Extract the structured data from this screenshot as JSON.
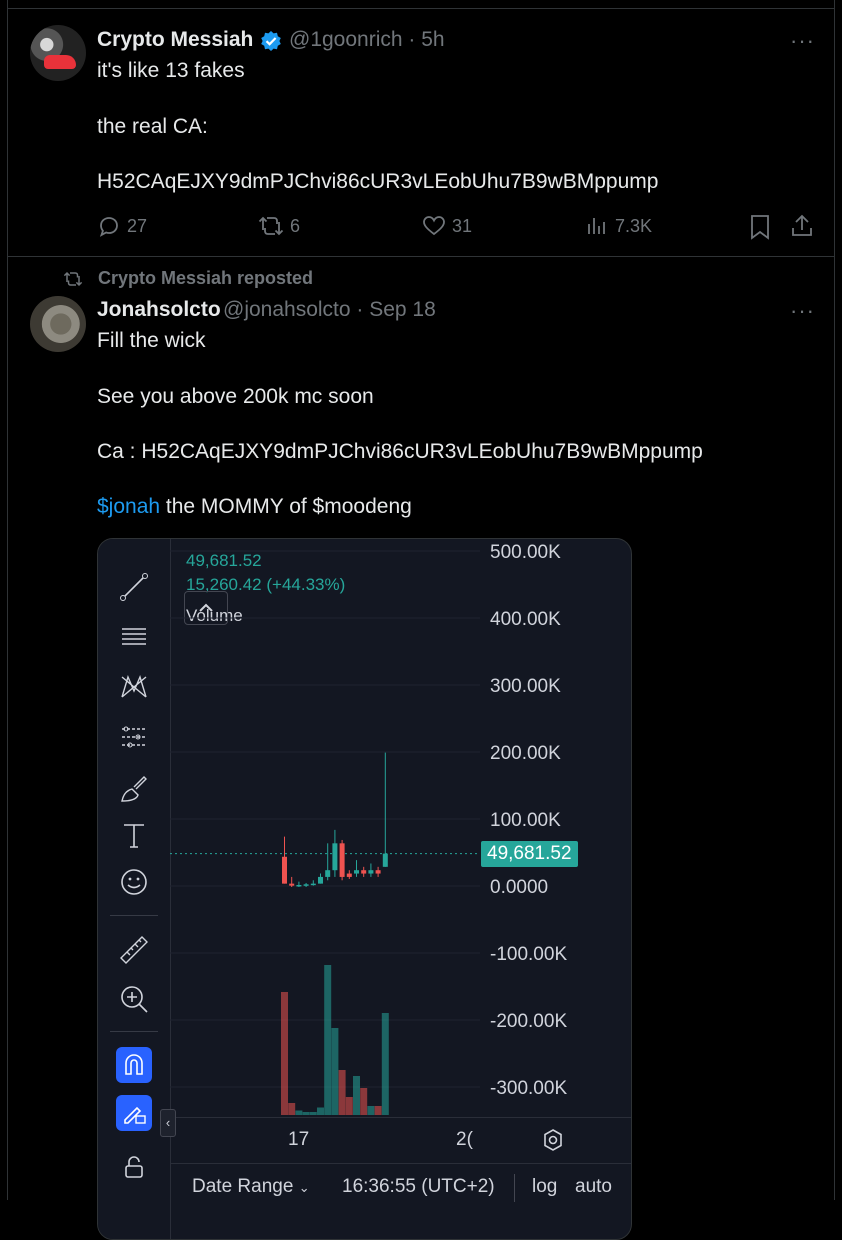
{
  "tweet1": {
    "name": "Crypto Messiah",
    "handle": "@1goonrich · 5h",
    "lines": [
      "it's like 13 fakes",
      "the real CA:",
      "H52CAqEJXY9dmPJChvi86cUR3vLEobUhu7B9wBMppump"
    ],
    "replies": "27",
    "reposts": "6",
    "likes": "31",
    "views": "7.3K",
    "more": "···"
  },
  "repost_label": "Crypto Messiah reposted",
  "tweet2": {
    "name": "Jonahsolcto",
    "handle": "@jonahsolcto · Sep 18",
    "lines": [
      "Fill the wick",
      "See you above 200k mc soon",
      "Ca : H52CAqEJXY9dmPJChvi86cUR3vLEobUhu7B9wBMppump"
    ],
    "cashtag": "$jonah",
    "last_line_rest": " the MOMMY of $moodeng",
    "more": "···"
  },
  "chart": {
    "price": "49,681.52",
    "change": "15,260.42 (+44.33%)",
    "volume_label": "Volume",
    "y_ticks": [
      "500.00K",
      "400.00K",
      "300.00K",
      "200.00K",
      "100.00K",
      "0.0000",
      "-100.00K",
      "-200.00K",
      "-300.00K"
    ],
    "last_price_tag": "49,681.52",
    "x_ticks": [
      "17",
      "2("
    ],
    "bottom": {
      "date_range": "Date Range",
      "time": "16:36:55 (UTC+2)",
      "log": "log",
      "auto": "auto"
    },
    "colors": {
      "up": "#26a69a",
      "down": "#ef5350",
      "bg": "#131722",
      "accent": "#2962ff"
    }
  },
  "chart_data": {
    "type": "candlestick",
    "title": "",
    "ylim": [
      -300000,
      500000
    ],
    "last_price": 49681.52,
    "change": 15260.42,
    "change_pct": 44.33,
    "candles": [
      {
        "o": 45000,
        "h": 75000,
        "l": 5000,
        "c": 5000,
        "dir": "down"
      },
      {
        "o": 5000,
        "h": 15000,
        "l": 0,
        "c": 2000,
        "dir": "down"
      },
      {
        "o": 2000,
        "h": 8000,
        "l": 0,
        "c": 3000,
        "dir": "up"
      },
      {
        "o": 3000,
        "h": 6000,
        "l": 0,
        "c": 4000,
        "dir": "up"
      },
      {
        "o": 4000,
        "h": 10000,
        "l": 2000,
        "c": 5000,
        "dir": "up"
      },
      {
        "o": 5000,
        "h": 20000,
        "l": 5000,
        "c": 15000,
        "dir": "up"
      },
      {
        "o": 15000,
        "h": 65000,
        "l": 10000,
        "c": 25000,
        "dir": "up"
      },
      {
        "o": 25000,
        "h": 85000,
        "l": 15000,
        "c": 65000,
        "dir": "up"
      },
      {
        "o": 65000,
        "h": 70000,
        "l": 10000,
        "c": 15000,
        "dir": "down"
      },
      {
        "o": 15000,
        "h": 25000,
        "l": 12000,
        "c": 20000,
        "dir": "down"
      },
      {
        "o": 20000,
        "h": 40000,
        "l": 15000,
        "c": 25000,
        "dir": "up"
      },
      {
        "o": 25000,
        "h": 30000,
        "l": 15000,
        "c": 20000,
        "dir": "down"
      },
      {
        "o": 20000,
        "h": 35000,
        "l": 15000,
        "c": 25000,
        "dir": "up"
      },
      {
        "o": 25000,
        "h": 30000,
        "l": 15000,
        "c": 20000,
        "dir": "down"
      },
      {
        "o": 30000,
        "h": 200000,
        "l": 30000,
        "c": 49681.52,
        "dir": "up"
      }
    ],
    "volume_relative": [
      0.82,
      0.08,
      0.03,
      0.02,
      0.02,
      0.05,
      1.0,
      0.58,
      0.3,
      0.12,
      0.26,
      0.18,
      0.06,
      0.06,
      0.68
    ]
  }
}
